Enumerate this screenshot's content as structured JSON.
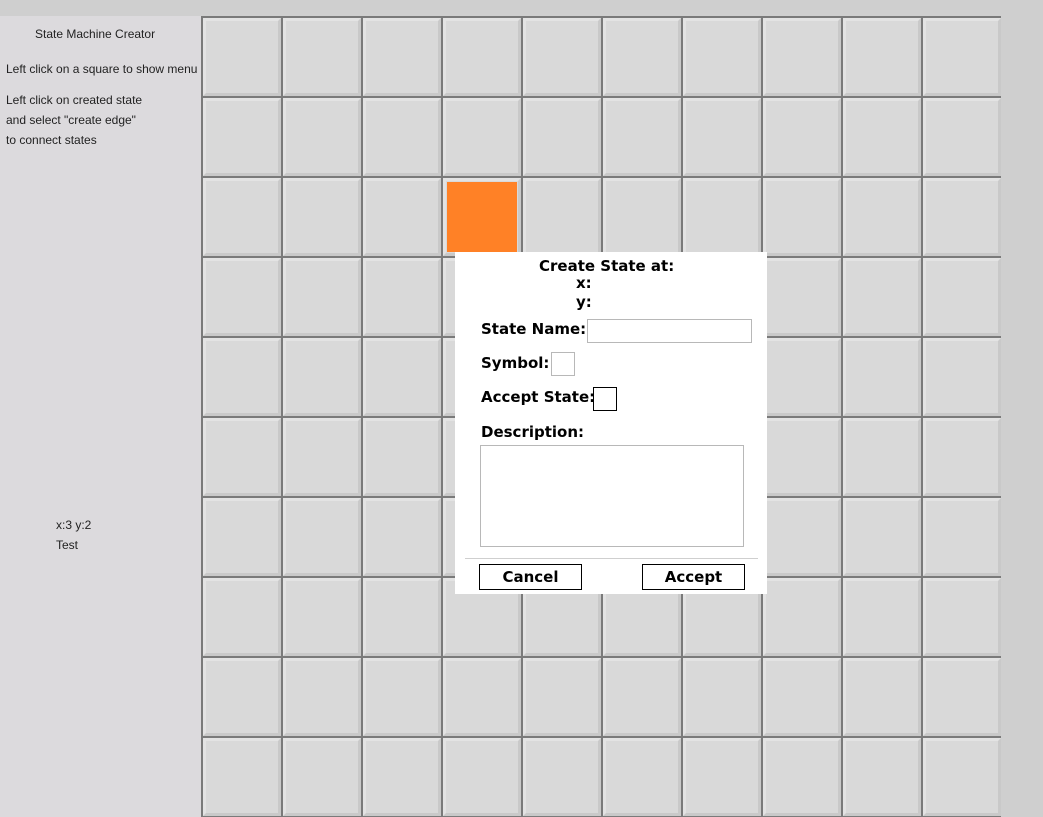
{
  "sidebar": {
    "title": "State Machine Creator",
    "instructions": [
      "Left click on a square to show menu",
      "Left click on created state",
      "and select \"create edge\"",
      "to connect states"
    ],
    "status": {
      "coords": "x:3 y:2",
      "name": "Test"
    }
  },
  "grid": {
    "columns": 10,
    "rows": 10,
    "created_states": [
      {
        "col": 3,
        "row": 2,
        "color": "#ff8126"
      }
    ]
  },
  "dialog": {
    "title": "Create State at:",
    "x_label": "x:",
    "y_label": "y:",
    "state_name_label": "State Name:",
    "state_name_value": "",
    "symbol_label": "Symbol:",
    "symbol_value": "",
    "accept_state_label": "Accept State:",
    "accept_state_checked": false,
    "description_label": "Description:",
    "description_value": "",
    "cancel_label": "Cancel",
    "accept_label": "Accept"
  }
}
